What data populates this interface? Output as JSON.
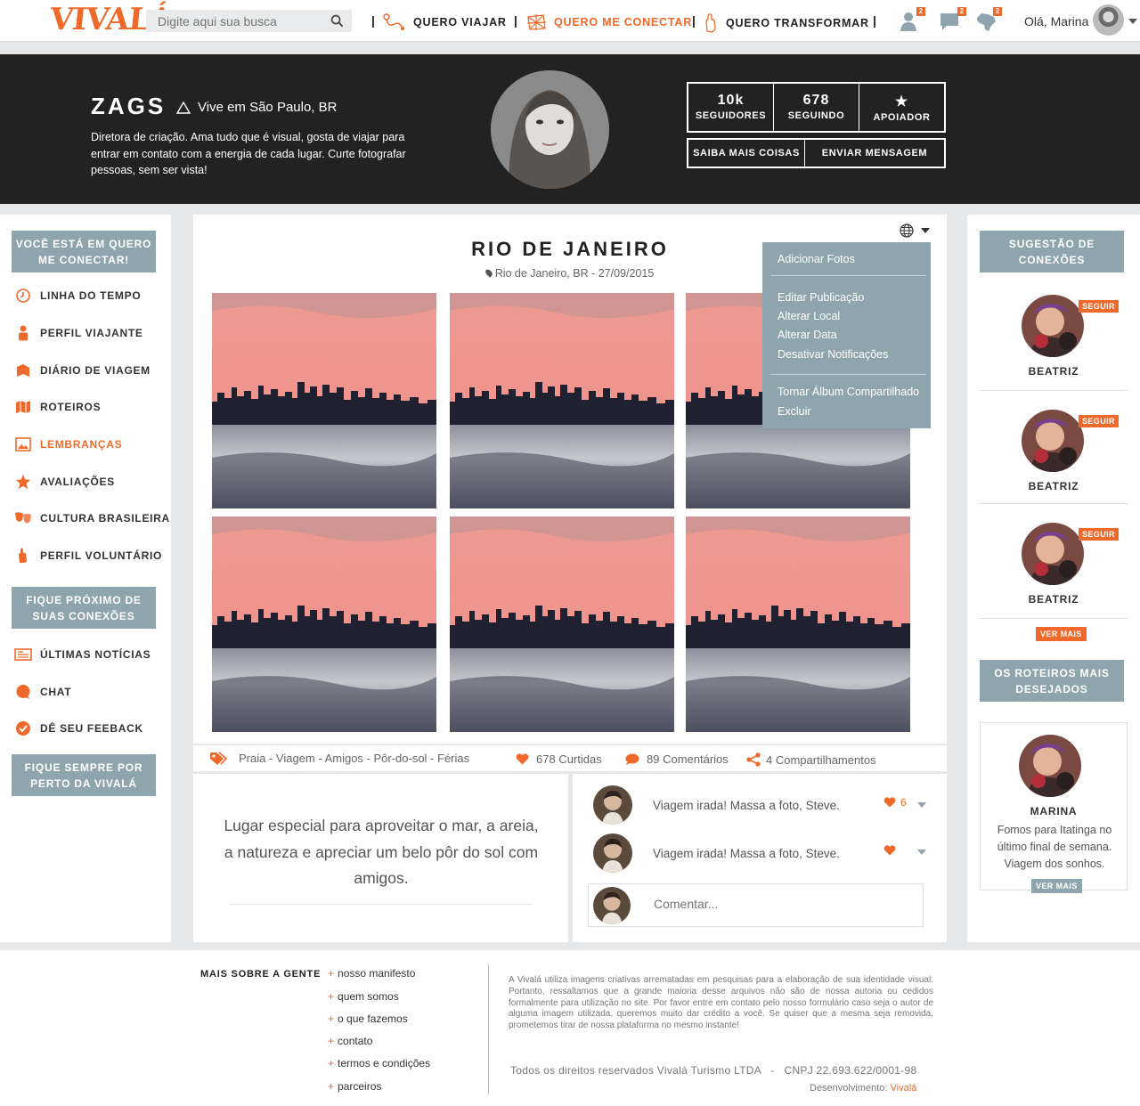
{
  "brand": {
    "logo": "VIVALÁ",
    "accent": "#ef6a2a",
    "slate": "#8fa5ad",
    "dark": "#222223"
  },
  "header": {
    "search_placeholder": "Digite aqui sua busca",
    "nav": [
      {
        "label": "QUERO VIAJAR",
        "icon": "route-icon"
      },
      {
        "label": "QUERO ME CONECTAR",
        "icon": "network-icon",
        "active": true
      },
      {
        "label": "QUERO TRANSFORMAR",
        "icon": "hand-icon"
      }
    ],
    "separator": "|",
    "badges": {
      "friends": "2",
      "messages": "2",
      "map": "2"
    },
    "greeting": "Olá, Marina"
  },
  "profile": {
    "name": "ZAGS",
    "location": "Vive em São Paulo, BR",
    "bio": "Diretora de criação. Ama tudo que é visual, gosta de viajar para entrar em contato com a energia de cada lugar. Curte fotografar pessoas, sem ser vista!",
    "stats": [
      {
        "value": "10k",
        "label": "SEGUIDORES"
      },
      {
        "value": "678",
        "label": "SEGUINDO"
      },
      {
        "value": "★",
        "label": "APOIADOR"
      }
    ],
    "actions": [
      "SAIBA MAIS COISAS",
      "ENVIAR MENSAGEM"
    ]
  },
  "left_sidebar": {
    "section1": "VOCÊ ESTÁ EM QUERO ME CONECTAR!",
    "items": [
      {
        "label": "LINHA DO TEMPO",
        "icon": "clock-icon"
      },
      {
        "label": "PERFIL VIAJANTE",
        "icon": "person-icon"
      },
      {
        "label": "DIÁRIO DE VIAGEM",
        "icon": "book-icon"
      },
      {
        "label": "ROTEIROS",
        "icon": "map-icon"
      },
      {
        "label": "LEMBRANÇAS",
        "icon": "image-icon",
        "active": true
      },
      {
        "label": "AVALIAÇÕES",
        "icon": "star-icon"
      },
      {
        "label": "CULTURA BRASILEIRA",
        "icon": "masks-icon"
      },
      {
        "label": "PERFIL VOLUNTÁRIO",
        "icon": "hand-icon"
      }
    ],
    "section2": "FIQUE PRÓXIMO DE SUAS CONEXÕES",
    "items2": [
      {
        "label": "ÚLTIMAS NOTÍCIAS",
        "icon": "newspaper-icon"
      },
      {
        "label": "CHAT",
        "icon": "chat-icon"
      },
      {
        "label": "DÊ SEU FEEBACK",
        "icon": "check-icon"
      }
    ],
    "section3": "FIQUE SEMPRE POR PERTO DA VIVALÁ"
  },
  "post": {
    "title": "RIO DE JANEIRO",
    "location": "Rio de Janeiro, BR - 27/09/2015",
    "tags": "Praia - Viagem - Amigos - Pôr-do-sol - Férias",
    "likes": "678 Curtidas",
    "comments": "89 Comentários",
    "shares": "4 Compartilhamentos",
    "description": "Lugar especial para aproveitar o mar, a areia, a natureza e apreciar um belo pôr do sol com amigos."
  },
  "post_menu": {
    "items": [
      "Adicionar Fotos",
      "Editar Publicação",
      "Alterar Local",
      "Alterar Data",
      "Desativar Notificações",
      "Tornar Álbum Compartilhado",
      "Excluir"
    ]
  },
  "comments": [
    {
      "text": "Viagem irada! Massa a foto, Steve.",
      "likes": "6"
    },
    {
      "text": "Viagem irada! Massa a foto, Steve.",
      "likes": ""
    }
  ],
  "comment_placeholder": "Comentar...",
  "right_sidebar": {
    "suggest_title": "SUGESTÃO DE CONEXÕES",
    "follow_label": "SEGUIR",
    "suggestions": [
      {
        "name": "BEATRIZ"
      },
      {
        "name": "BEATRIZ"
      },
      {
        "name": "BEATRIZ"
      }
    ],
    "ver_mais": "VER MAIS",
    "itineraries_title": "OS ROTEIROS MAIS DESEJADOS",
    "card": {
      "name": "MARINA",
      "text": "Fomos para Itatinga no último final de semana. Viagem dos sonhos."
    }
  },
  "footer": {
    "title": "MAIS SOBRE A GENTE",
    "links": [
      "nosso manifesto",
      "quem somos",
      "o que fazemos",
      "contato",
      "termos e condições",
      "parceiros"
    ],
    "disclaimer": "A Vivalá utiliza imagens criativas arrematadas em pesquisas para a elaboração de sua identidade visual. Portanto, ressaltamos que a grande maioria desse arquivos não são de nossa autoria ou cedidos formalmente para utilização no site. Por favor entre em contato pelo nosso formulário caso seja o autor de alguma imagem utilizada, queremos muito dar crédito a você. Se quiser que a mesma seja removida, prometemos tirar de nossa plataforma no mesmo instante!",
    "rights": "Todos os direitos reservados Vivalá Turismo LTDA   -   CNPJ 22.693.622/0001-98",
    "dev_label": "Desenvolvimento:",
    "dev_name": "Vivalá"
  }
}
